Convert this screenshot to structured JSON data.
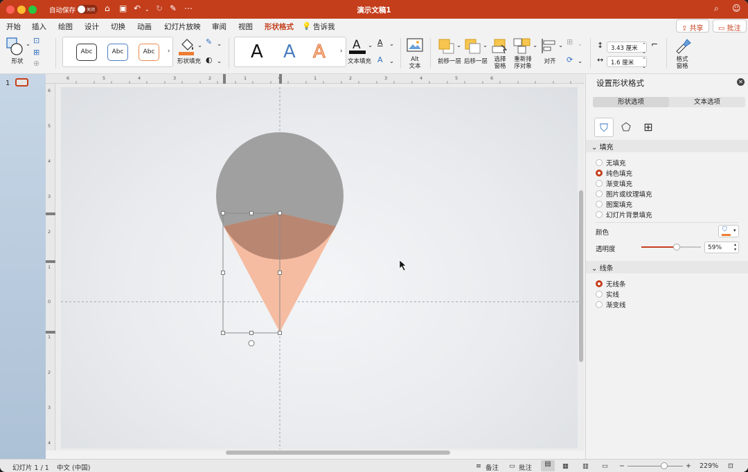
{
  "titlebar": {
    "autosave_label": "自动保存",
    "autosave_state": "关闭",
    "doc_title": "演示文稿1",
    "icons": [
      "home-icon",
      "save-icon",
      "undo-icon",
      "redo-icon",
      "customize-icon",
      "more-icon",
      "search-icon",
      "people-icon"
    ]
  },
  "menu": {
    "tabs": [
      "开始",
      "插入",
      "绘图",
      "设计",
      "切换",
      "动画",
      "幻灯片放映",
      "审阅",
      "视图",
      "形状格式"
    ],
    "active_tab": "形状格式",
    "tell_me": "告诉我",
    "share": "共享",
    "comments": "批注"
  },
  "ribbon": {
    "shapes_label": "形状",
    "style_samples": [
      "Abc",
      "Abc",
      "Abc"
    ],
    "shape_fill_label": "形状填充",
    "text_fill_label": "文本填充",
    "alt_text_label_1": "Alt",
    "alt_text_label_2": "文本",
    "bring_forward": "前移一层",
    "send_backward": "后移一层",
    "selection_pane_1": "选择",
    "selection_pane_2": "窗格",
    "reorder_1": "重新排",
    "reorder_2": "序对象",
    "align": "对齐",
    "height_value": "3.43 厘米",
    "width_value": "1.6 厘米",
    "format_pane_1": "格式",
    "format_pane_2": "窗格"
  },
  "thumbnails": {
    "slide_number": "1"
  },
  "rulers": {
    "h_ticks": [
      "6",
      "5",
      "4",
      "3",
      "2",
      "1",
      "0",
      "1",
      "2",
      "3",
      "4",
      "5",
      "6"
    ],
    "v_ticks": [
      "6",
      "5",
      "4",
      "3",
      "2",
      "1",
      "0",
      "1",
      "2",
      "3",
      "4"
    ]
  },
  "pane": {
    "title": "设置形状格式",
    "tab_shape": "形状选项",
    "tab_text": "文本选项",
    "fill_section": "填充",
    "fill_options": [
      "无填充",
      "纯色填充",
      "渐变填充",
      "图片或纹理填充",
      "图案填充",
      "幻灯片背景填充"
    ],
    "fill_selected": "纯色填充",
    "color_label": "颜色",
    "transparency_label": "透明度",
    "transparency_value": "59%",
    "transparency_level": 0.59,
    "line_section": "线条",
    "line_options": [
      "无线条",
      "实线",
      "渐变线"
    ],
    "line_selected": "无线条"
  },
  "colors": {
    "accent": "#c43e1c",
    "circle": "#a0a0a0",
    "triangle": "#f4b89c",
    "overlap": "#b98672"
  },
  "status": {
    "slide_info": "幻灯片 1 / 1",
    "language": "中文 (中国)",
    "notes": "备注",
    "comments": "批注",
    "zoom": "229%"
  }
}
